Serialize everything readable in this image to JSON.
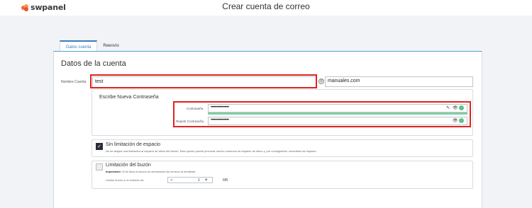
{
  "brand": {
    "name": "swpanel"
  },
  "page": {
    "title": "Crear cuenta de correo"
  },
  "tabs": [
    {
      "label": "Datos cuenta",
      "active": true
    },
    {
      "label": "Reenvío",
      "active": false
    }
  ],
  "form": {
    "section_title": "Datos de la cuenta",
    "account_name": {
      "label": "Nombre Cuenta",
      "value": "test"
    },
    "at_symbol": "@",
    "domain": {
      "value": "manuales.com"
    },
    "password_section": {
      "title": "Escribe Nueva Contraseña",
      "password": {
        "label": "Contraseña",
        "value": "••••••••••••••••"
      },
      "repeat": {
        "label": "Repetir Contraseña",
        "value": "••••••••••••••••"
      }
    },
    "unlimited": {
      "checked": true,
      "title": "Sin limitación de espacio",
      "description": "No se asigna una limitación al espacio de disco del buzón. Esta opción puede provocar mucho consumo de espacio de disco y, por consiguiente, excedidos de espacio."
    },
    "mailbox_limit": {
      "checked": false,
      "title": "Limitación del buzón",
      "important_label": "Importante:",
      "important_text": "Si se llena el buzón se devolverán los correos al remitente.",
      "max_label": "Limitar buzón a un máximo de",
      "stepper_minus": "−",
      "stepper_value": "1",
      "stepper_plus": "+",
      "unit": "MB"
    }
  },
  "icons": {
    "edit": "pencil-icon",
    "show": "eye-icon",
    "status": "status-dot-icon"
  },
  "colors": {
    "accent": "#3b7bc0",
    "highlight": "#e0221d",
    "strength": "#82cfa4",
    "ok": "#5cc28e"
  }
}
